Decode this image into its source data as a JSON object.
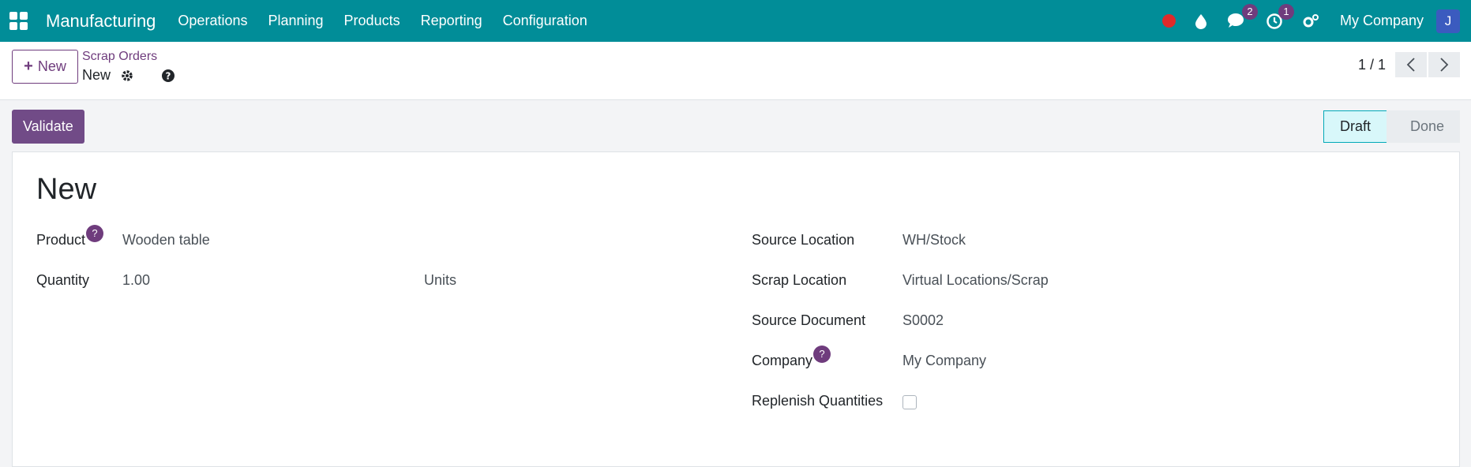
{
  "navbar": {
    "brand": "Manufacturing",
    "menu": [
      "Operations",
      "Planning",
      "Products",
      "Reporting",
      "Configuration"
    ],
    "messages_count": "2",
    "activities_count": "1",
    "company": "My Company",
    "avatar_initial": "J"
  },
  "control_panel": {
    "new_label": "New",
    "breadcrumb_parent": "Scrap Orders",
    "breadcrumb_current": "New",
    "pager_value": "1 / 1"
  },
  "statusbar": {
    "validate_label": "Validate",
    "stages": [
      "Draft",
      "Done"
    ],
    "active_stage": "Draft"
  },
  "form": {
    "title": "New",
    "product_label": "Product",
    "product_value": "Wooden table",
    "quantity_label": "Quantity",
    "quantity_value": "1.00",
    "uom_value": "Units",
    "source_location_label": "Source Location",
    "source_location_value": "WH/Stock",
    "scrap_location_label": "Scrap Location",
    "scrap_location_value": "Virtual Locations/Scrap",
    "source_document_label": "Source Document",
    "source_document_value": "S0002",
    "company_label": "Company",
    "company_value": "My Company",
    "replenish_label": "Replenish Quantities",
    "replenish_checked": false,
    "help_mark": "?"
  },
  "colors": {
    "navbar": "#018d98",
    "primary": "#714b87",
    "badge": "#6f3c7d"
  }
}
